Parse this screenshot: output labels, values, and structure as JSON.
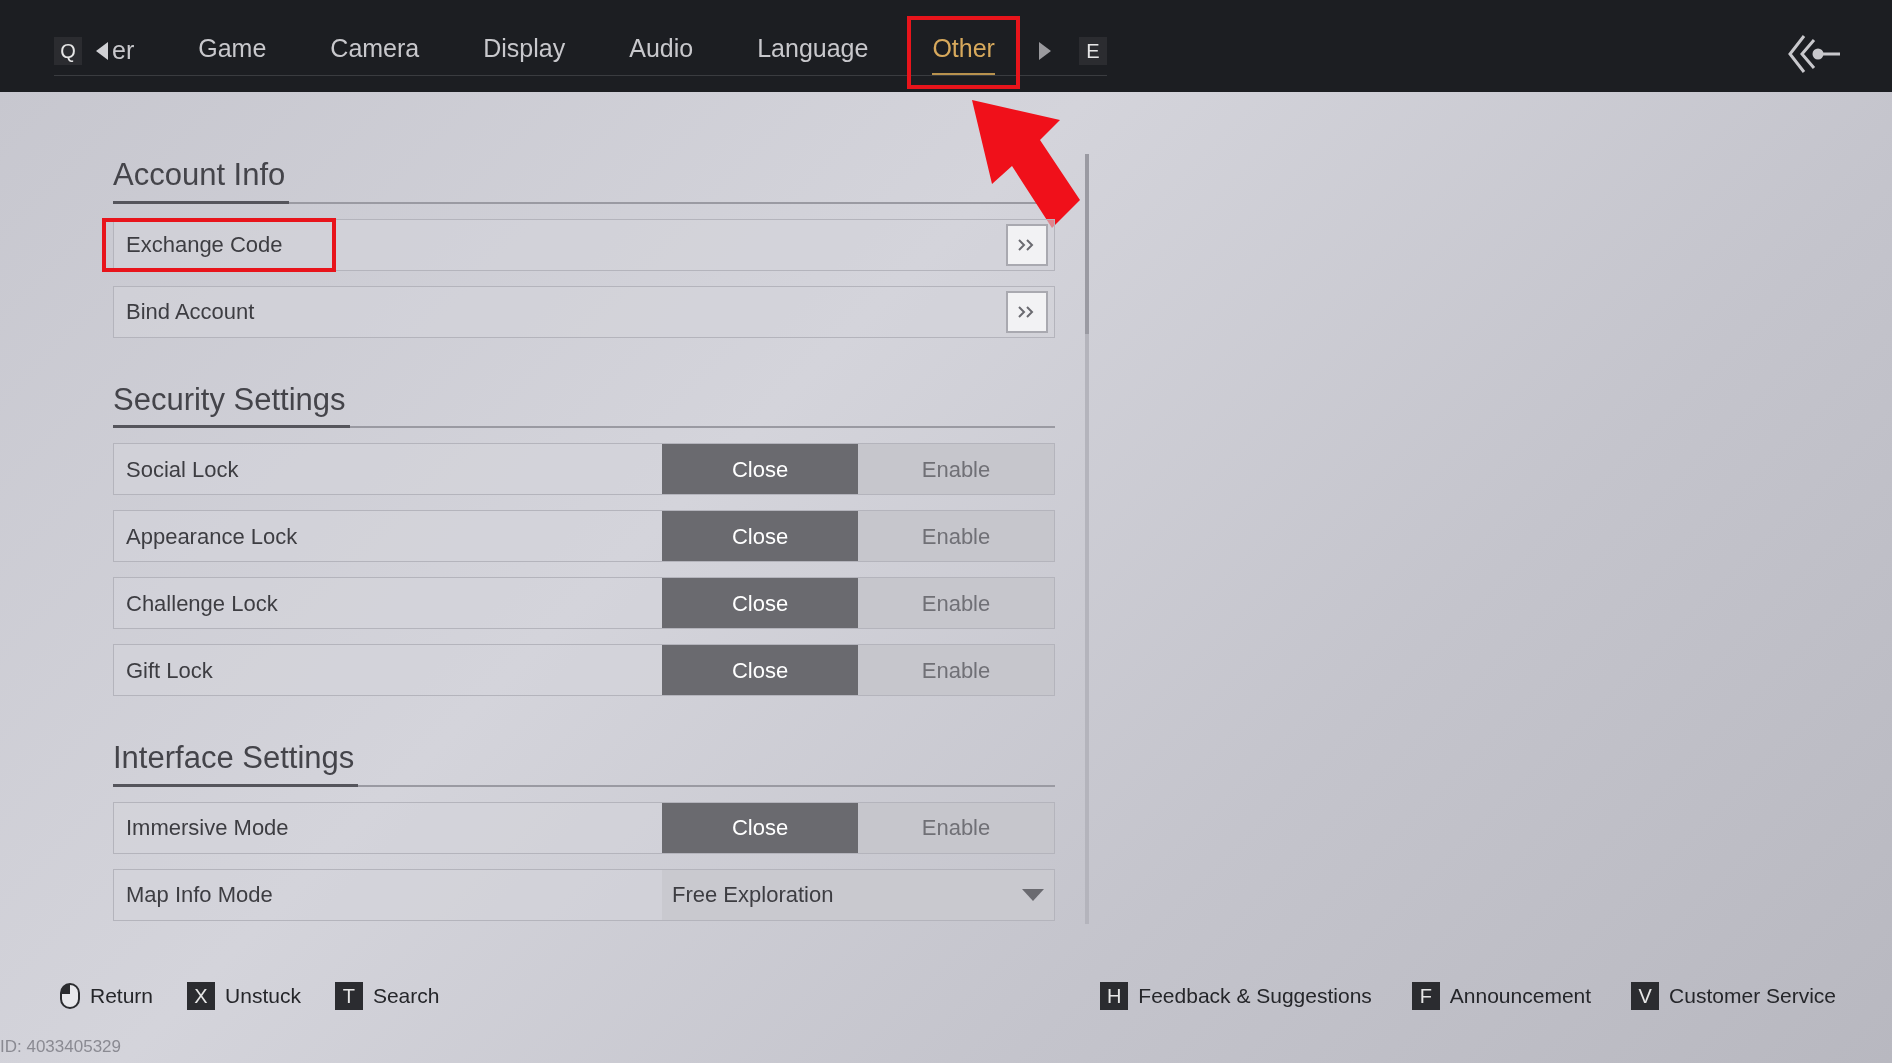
{
  "tab_bar": {
    "prev_key": "Q",
    "partial_tab": "er",
    "next_key": "E",
    "tabs": [
      {
        "label": "Game",
        "selected": false,
        "annotated": false
      },
      {
        "label": "Camera",
        "selected": false,
        "annotated": false
      },
      {
        "label": "Display",
        "selected": false,
        "annotated": false
      },
      {
        "label": "Audio",
        "selected": false,
        "annotated": false
      },
      {
        "label": "Language",
        "selected": false,
        "annotated": false
      },
      {
        "label": "Other",
        "selected": true,
        "annotated": true
      }
    ]
  },
  "sections": [
    {
      "title": "Account Info",
      "rows": [
        {
          "kind": "link",
          "label": "Exchange Code",
          "annotated": true
        },
        {
          "kind": "link",
          "label": "Bind Account",
          "annotated": false
        }
      ]
    },
    {
      "title": "Security Settings",
      "rows": [
        {
          "kind": "toggle",
          "label": "Social Lock",
          "options": [
            {
              "label": "Close",
              "selected": true
            },
            {
              "label": "Enable",
              "selected": false
            }
          ]
        },
        {
          "kind": "toggle",
          "label": "Appearance Lock",
          "options": [
            {
              "label": "Close",
              "selected": true
            },
            {
              "label": "Enable",
              "selected": false
            }
          ]
        },
        {
          "kind": "toggle",
          "label": "Challenge Lock",
          "options": [
            {
              "label": "Close",
              "selected": true
            },
            {
              "label": "Enable",
              "selected": false
            }
          ]
        },
        {
          "kind": "toggle",
          "label": "Gift Lock",
          "options": [
            {
              "label": "Close",
              "selected": true
            },
            {
              "label": "Enable",
              "selected": false
            }
          ]
        }
      ]
    },
    {
      "title": "Interface Settings",
      "rows": [
        {
          "kind": "toggle",
          "label": "Immersive Mode",
          "options": [
            {
              "label": "Close",
              "selected": true
            },
            {
              "label": "Enable",
              "selected": false
            }
          ]
        },
        {
          "kind": "dropdown",
          "label": "Map Info Mode",
          "value": "Free Exploration"
        }
      ]
    }
  ],
  "footer": {
    "left": [
      {
        "kind": "mouse",
        "label": "Return"
      },
      {
        "kind": "key",
        "key": "X",
        "label": "Unstuck"
      },
      {
        "kind": "key",
        "key": "T",
        "label": "Search"
      }
    ],
    "right": [
      {
        "key": "H",
        "label": "Feedback & Suggestions"
      },
      {
        "key": "F",
        "label": "Announcement"
      },
      {
        "key": "V",
        "label": "Customer Service"
      }
    ]
  },
  "id_text": "ID: 4033405329"
}
